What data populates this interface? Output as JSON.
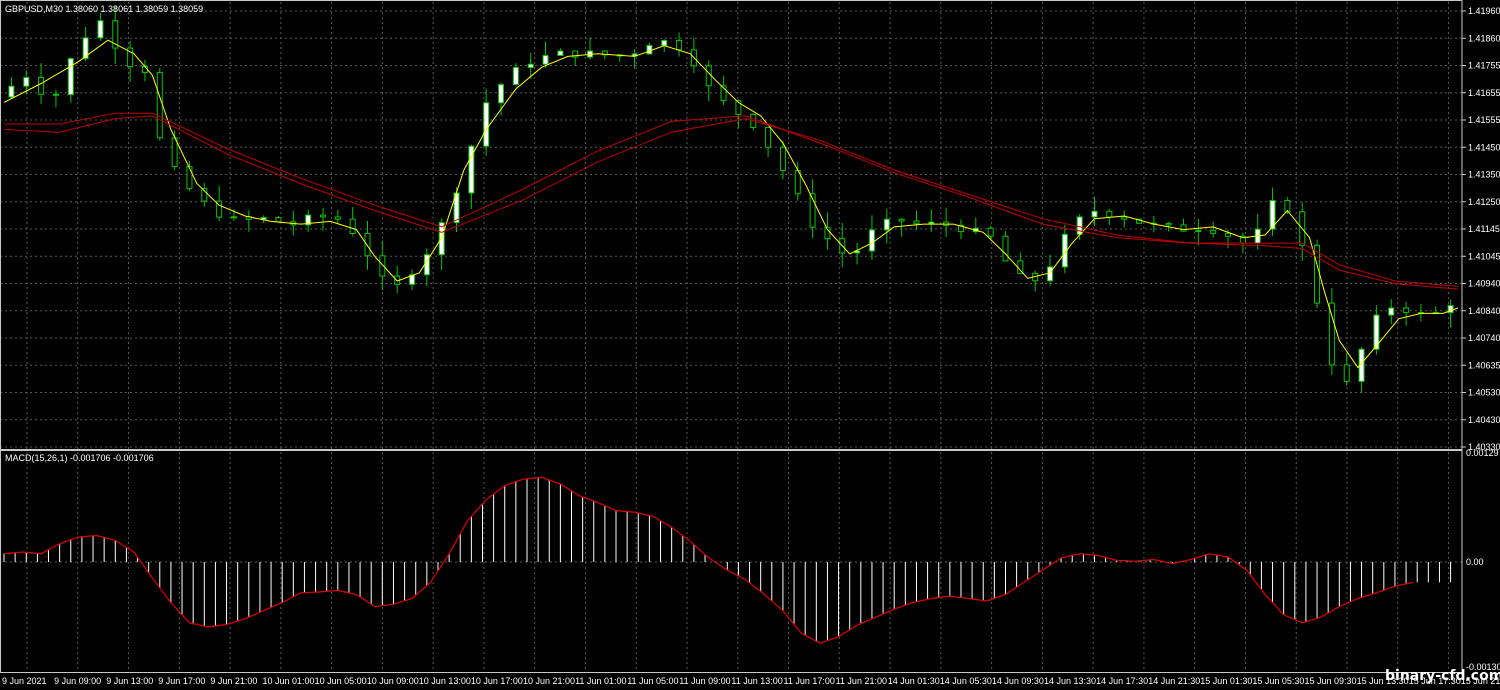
{
  "header": {
    "symbol_info": "GBPUSD,M30  1.38060 1.38061 1.38059 1.38059"
  },
  "macd_panel": {
    "indicator_info": "MACD(15,26,1) -0.001706 -0.001706"
  },
  "watermark": "binary-cfd.com",
  "colors": {
    "background": "#000000",
    "grid": "#5a5a5a",
    "bull_candle": "#ffffff",
    "bear_candle": "#000000",
    "candle_wick": "#00c800",
    "fast_ma": "#ffff00",
    "slow_ma": "#c00000",
    "macd_histogram": "#ffffff",
    "macd_signal": "#e00000"
  },
  "chart_data": [
    {
      "type": "candlestick",
      "title": "GBPUSD,M30",
      "ohlc_readout": [
        1.3806,
        1.38061,
        1.38059,
        1.38059
      ],
      "price_ticks": [
        "1.41960",
        "1.41860",
        "1.41755",
        "1.41655",
        "1.41555",
        "1.41450",
        "1.41350",
        "1.41250",
        "1.41145",
        "1.41045",
        "1.40940",
        "1.40840",
        "1.40740",
        "1.40635",
        "1.40530",
        "1.40430",
        "1.40330"
      ],
      "ylim": [
        1.4033,
        1.4196
      ],
      "time_ticks": [
        "9 Jun 2021",
        "9 Jun 09:00",
        "9 Jun 13:00",
        "9 Jun 17:00",
        "9 Jun 21:00",
        "10 Jun 01:00",
        "10 Jun 05:00",
        "10 Jun 09:00",
        "10 Jun 13:00",
        "10 Jun 17:00",
        "10 Jun 21:00",
        "11 Jun 01:00",
        "11 Jun 05:00",
        "11 Jun 09:00",
        "11 Jun 13:00",
        "11 Jun 17:00",
        "11 Jun 21:00",
        "14 Jun 01:30",
        "14 Jun 05:30",
        "14 Jun 09:30",
        "14 Jun 13:30",
        "14 Jun 17:30",
        "14 Jun 21:30",
        "15 Jun 01:30",
        "15 Jun 05:30",
        "15 Jun 09:30",
        "15 Jun 13:30",
        "15 Jun 17:30",
        "15 Jun 21:30"
      ],
      "close_path": [
        [
          0,
          1.4162
        ],
        [
          8,
          1.417
        ],
        [
          15,
          1.416
        ],
        [
          22,
          1.4182
        ],
        [
          28,
          1.419
        ],
        [
          35,
          1.4175
        ],
        [
          40,
          1.4172
        ],
        [
          45,
          1.414
        ],
        [
          52,
          1.4128
        ],
        [
          58,
          1.412
        ],
        [
          65,
          1.4116
        ],
        [
          72,
          1.4117
        ],
        [
          80,
          1.4115
        ],
        [
          86,
          1.4118
        ],
        [
          92,
          1.4117
        ],
        [
          98,
          1.411
        ],
        [
          103,
          1.4095
        ],
        [
          108,
          1.4092
        ],
        [
          115,
          1.4102
        ],
        [
          122,
          1.412
        ],
        [
          127,
          1.414
        ],
        [
          132,
          1.416
        ],
        [
          138,
          1.417
        ],
        [
          145,
          1.4176
        ],
        [
          152,
          1.4178
        ],
        [
          160,
          1.4178
        ],
        [
          170,
          1.4177
        ],
        [
          177,
          1.4183
        ],
        [
          183,
          1.4182
        ],
        [
          188,
          1.4175
        ],
        [
          193,
          1.4163
        ],
        [
          198,
          1.4158
        ],
        [
          204,
          1.4152
        ],
        [
          210,
          1.414
        ],
        [
          216,
          1.4125
        ],
        [
          220,
          1.4115
        ],
        [
          226,
          1.4107
        ],
        [
          230,
          1.4102
        ],
        [
          236,
          1.4112
        ],
        [
          242,
          1.4117
        ],
        [
          248,
          1.4115
        ],
        [
          255,
          1.4115
        ],
        [
          262,
          1.4113
        ],
        [
          268,
          1.411
        ],
        [
          274,
          1.4097
        ],
        [
          279,
          1.4093
        ],
        [
          284,
          1.41
        ],
        [
          290,
          1.4115
        ],
        [
          296,
          1.412
        ],
        [
          303,
          1.4118
        ],
        [
          310,
          1.4115
        ],
        [
          318,
          1.4113
        ],
        [
          326,
          1.4114
        ],
        [
          332,
          1.4111
        ],
        [
          336,
          1.4108
        ],
        [
          340,
          1.4112
        ],
        [
          345,
          1.4125
        ],
        [
          350,
          1.4118
        ],
        [
          354,
          1.4095
        ],
        [
          358,
          1.4078
        ],
        [
          362,
          1.405
        ],
        [
          366,
          1.4062
        ],
        [
          370,
          1.4075
        ],
        [
          374,
          1.4085
        ],
        [
          378,
          1.4084
        ],
        [
          382,
          1.4083
        ],
        [
          386,
          1.408
        ],
        [
          392,
          1.4086
        ]
      ],
      "series": [
        {
          "name": "",
          "kind": "fast_ma",
          "values": [
            [
              0,
              1.416
            ],
            [
              10,
              1.4167
            ],
            [
              20,
              1.4175
            ],
            [
              28,
              1.4183
            ],
            [
              35,
              1.4178
            ],
            [
              40,
              1.417
            ],
            [
              45,
              1.415
            ],
            [
              52,
              1.413
            ],
            [
              58,
              1.4122
            ],
            [
              65,
              1.4118
            ],
            [
              72,
              1.4116
            ],
            [
              80,
              1.4115
            ],
            [
              88,
              1.4116
            ],
            [
              95,
              1.4113
            ],
            [
              100,
              1.4103
            ],
            [
              106,
              1.4094
            ],
            [
              112,
              1.4097
            ],
            [
              118,
              1.411
            ],
            [
              124,
              1.4135
            ],
            [
              130,
              1.415
            ],
            [
              138,
              1.4165
            ],
            [
              145,
              1.4173
            ],
            [
              152,
              1.4177
            ],
            [
              160,
              1.4178
            ],
            [
              170,
              1.4177
            ],
            [
              178,
              1.4181
            ],
            [
              185,
              1.4178
            ],
            [
              192,
              1.4168
            ],
            [
              198,
              1.416
            ],
            [
              204,
              1.4155
            ],
            [
              210,
              1.4145
            ],
            [
              216,
              1.413
            ],
            [
              222,
              1.4113
            ],
            [
              228,
              1.4104
            ],
            [
              234,
              1.4108
            ],
            [
              240,
              1.4114
            ],
            [
              248,
              1.4115
            ],
            [
              256,
              1.4115
            ],
            [
              264,
              1.4112
            ],
            [
              270,
              1.4104
            ],
            [
              276,
              1.4095
            ],
            [
              282,
              1.4097
            ],
            [
              288,
              1.4108
            ],
            [
              294,
              1.4117
            ],
            [
              302,
              1.4118
            ],
            [
              310,
              1.4115
            ],
            [
              318,
              1.4113
            ],
            [
              326,
              1.4114
            ],
            [
              334,
              1.411
            ],
            [
              340,
              1.4111
            ],
            [
              346,
              1.412
            ],
            [
              352,
              1.411
            ],
            [
              356,
              1.409
            ],
            [
              360,
              1.4072
            ],
            [
              365,
              1.4062
            ],
            [
              370,
              1.407
            ],
            [
              376,
              1.408
            ],
            [
              382,
              1.4082
            ],
            [
              388,
              1.4082
            ],
            [
              392,
              1.4084
            ]
          ]
        },
        {
          "name": "",
          "kind": "slow_ma_1",
          "values": [
            [
              0,
              1.4152
            ],
            [
              15,
              1.4152
            ],
            [
              30,
              1.4156
            ],
            [
              40,
              1.4156
            ],
            [
              60,
              1.4143
            ],
            [
              80,
              1.4132
            ],
            [
              100,
              1.4122
            ],
            [
              118,
              1.4114
            ],
            [
              140,
              1.4128
            ],
            [
              160,
              1.4142
            ],
            [
              180,
              1.4153
            ],
            [
              200,
              1.4155
            ],
            [
              220,
              1.4145
            ],
            [
              240,
              1.4134
            ],
            [
              260,
              1.4125
            ],
            [
              280,
              1.4115
            ],
            [
              300,
              1.411
            ],
            [
              320,
              1.4108
            ],
            [
              340,
              1.4108
            ],
            [
              350,
              1.4108
            ],
            [
              360,
              1.41
            ],
            [
              375,
              1.4094
            ],
            [
              392,
              1.4092
            ]
          ]
        },
        {
          "name": "",
          "kind": "slow_ma_2",
          "values": [
            [
              0,
              1.415
            ],
            [
              15,
              1.4149
            ],
            [
              30,
              1.4154
            ],
            [
              40,
              1.4155
            ],
            [
              60,
              1.4141
            ],
            [
              80,
              1.413
            ],
            [
              100,
              1.412
            ],
            [
              118,
              1.4112
            ],
            [
              140,
              1.4124
            ],
            [
              160,
              1.4138
            ],
            [
              180,
              1.4149
            ],
            [
              200,
              1.4154
            ],
            [
              220,
              1.4146
            ],
            [
              240,
              1.4135
            ],
            [
              260,
              1.4126
            ],
            [
              280,
              1.4117
            ],
            [
              300,
              1.4111
            ],
            [
              320,
              1.4108
            ],
            [
              340,
              1.4107
            ],
            [
              350,
              1.4106
            ],
            [
              360,
              1.4098
            ],
            [
              375,
              1.4093
            ],
            [
              392,
              1.4091
            ]
          ]
        }
      ]
    },
    {
      "type": "bar",
      "title": "MACD(15,26,1)",
      "values_readout": [
        -0.001706,
        -0.001706
      ],
      "value_ticks": [
        "0.00129",
        "0.00",
        "-0.001306"
      ],
      "ylim": [
        -0.001306,
        0.00129
      ],
      "macd_path": [
        [
          0,
          0.0001
        ],
        [
          5,
          0.00012
        ],
        [
          10,
          0.0001
        ],
        [
          15,
          0.00022
        ],
        [
          20,
          0.0003
        ],
        [
          25,
          0.00032
        ],
        [
          30,
          0.00026
        ],
        [
          35,
          0.00012
        ],
        [
          40,
          -0.0002
        ],
        [
          45,
          -0.0005
        ],
        [
          50,
          -0.00075
        ],
        [
          55,
          -0.0008
        ],
        [
          60,
          -0.00077
        ],
        [
          65,
          -0.0007
        ],
        [
          70,
          -0.0006
        ],
        [
          75,
          -0.0005
        ],
        [
          80,
          -0.00038
        ],
        [
          85,
          -0.00037
        ],
        [
          90,
          -0.00035
        ],
        [
          95,
          -0.0004
        ],
        [
          100,
          -0.00055
        ],
        [
          105,
          -0.00052
        ],
        [
          110,
          -0.00045
        ],
        [
          115,
          -0.00025
        ],
        [
          120,
          0.0001
        ],
        [
          125,
          0.0005
        ],
        [
          130,
          0.00075
        ],
        [
          135,
          0.00092
        ],
        [
          140,
          0.001
        ],
        [
          145,
          0.00102
        ],
        [
          150,
          0.00094
        ],
        [
          155,
          0.0008
        ],
        [
          160,
          0.00072
        ],
        [
          165,
          0.00062
        ],
        [
          170,
          0.0006
        ],
        [
          175,
          0.00055
        ],
        [
          180,
          0.00042
        ],
        [
          185,
          0.00025
        ],
        [
          190,
          5e-05
        ],
        [
          195,
          -0.0001
        ],
        [
          200,
          -0.00022
        ],
        [
          205,
          -0.0004
        ],
        [
          210,
          -0.0006
        ],
        [
          215,
          -0.00088
        ],
        [
          220,
          -0.001
        ],
        [
          225,
          -0.00092
        ],
        [
          230,
          -0.00078
        ],
        [
          235,
          -0.00068
        ],
        [
          240,
          -0.00058
        ],
        [
          245,
          -0.0005
        ],
        [
          250,
          -0.00045
        ],
        [
          255,
          -0.00042
        ],
        [
          260,
          -0.00045
        ],
        [
          265,
          -0.00048
        ],
        [
          270,
          -0.0004
        ],
        [
          275,
          -0.00025
        ],
        [
          280,
          -0.0001
        ],
        [
          285,
          5e-05
        ],
        [
          290,
          0.0001
        ],
        [
          295,
          8e-05
        ],
        [
          300,
          2e-05
        ],
        [
          305,
          1e-05
        ],
        [
          310,
          3e-05
        ],
        [
          315,
          -2e-05
        ],
        [
          320,
          3e-05
        ],
        [
          325,
          0.0001
        ],
        [
          330,
          6e-05
        ],
        [
          335,
          -0.0001
        ],
        [
          340,
          -0.0004
        ],
        [
          345,
          -0.00065
        ],
        [
          350,
          -0.00075
        ],
        [
          355,
          -0.00068
        ],
        [
          360,
          -0.00055
        ],
        [
          365,
          -0.00045
        ],
        [
          370,
          -0.00038
        ],
        [
          375,
          -0.0003
        ],
        [
          380,
          -0.00025
        ]
      ],
      "signal_path_note": ""
    }
  ]
}
